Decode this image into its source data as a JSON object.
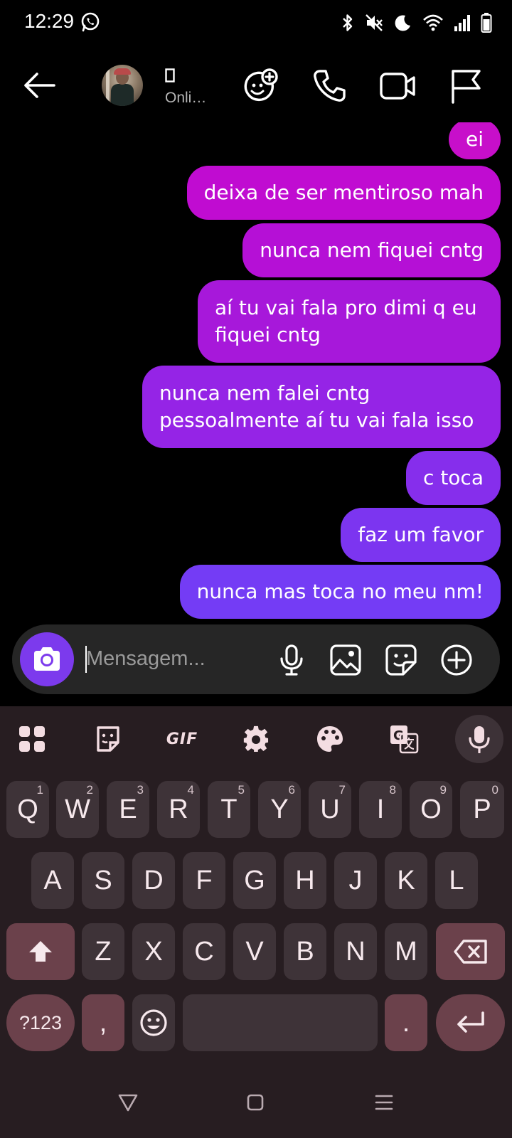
{
  "status_bar": {
    "time": "12:29",
    "icons": [
      "whatsapp-icon",
      "bluetooth-icon",
      "vibrate-off-icon",
      "dnd-moon-icon",
      "wifi-icon",
      "signal-icon",
      "battery-icon"
    ]
  },
  "header": {
    "contact_name": "",
    "contact_status": "Onli…",
    "icons": [
      "back-arrow-icon",
      "add-friend-icon",
      "phone-icon",
      "video-icon",
      "flag-icon"
    ]
  },
  "messages": [
    {
      "text": "ei",
      "color": "#c70fca"
    },
    {
      "text": "deixa de ser mentiroso mah",
      "color": "#c00cd1"
    },
    {
      "text": "nunca nem fiquei cntg",
      "color": "#b510d6"
    },
    {
      "text": "aí tu vai fala pro dimi q eu fiquei cntg",
      "color": "#a718da"
    },
    {
      "text": "nunca nem falei cntg pessoalmente aí tu vai fala isso",
      "color": "#9524e6"
    },
    {
      "text": "c toca",
      "color": "#862eec"
    },
    {
      "text": "faz um favor",
      "color": "#7c35f0"
    },
    {
      "text": "nunca mas toca no meu nm!",
      "color": "#743cf5"
    }
  ],
  "composer": {
    "placeholder": "Mensagem...",
    "accent": "#7c3aed",
    "icons": [
      "camera-icon",
      "microphone-icon",
      "gallery-icon",
      "sticker-icon",
      "plus-circle-icon"
    ]
  },
  "keyboard": {
    "toolbar": [
      "apps-grid-icon",
      "clipboard-sticker-icon",
      "GIF",
      "settings-gear-icon",
      "palette-icon",
      "translate-icon",
      "voice-mic-icon"
    ],
    "gif_label": "GIF",
    "row1": [
      {
        "label": "Q",
        "hint": "1"
      },
      {
        "label": "W",
        "hint": "2"
      },
      {
        "label": "E",
        "hint": "3"
      },
      {
        "label": "R",
        "hint": "4"
      },
      {
        "label": "T",
        "hint": "5"
      },
      {
        "label": "Y",
        "hint": "6"
      },
      {
        "label": "U",
        "hint": "7"
      },
      {
        "label": "I",
        "hint": "8"
      },
      {
        "label": "O",
        "hint": "9"
      },
      {
        "label": "P",
        "hint": "0"
      }
    ],
    "row2": [
      "A",
      "S",
      "D",
      "F",
      "G",
      "H",
      "J",
      "K",
      "L"
    ],
    "row3": [
      "Z",
      "X",
      "C",
      "V",
      "B",
      "N",
      "M"
    ],
    "symbols_label": "?123",
    "comma_label": ",",
    "period_label": ".",
    "key_color": "#3e3338",
    "special_key_color": "#6b414b"
  }
}
